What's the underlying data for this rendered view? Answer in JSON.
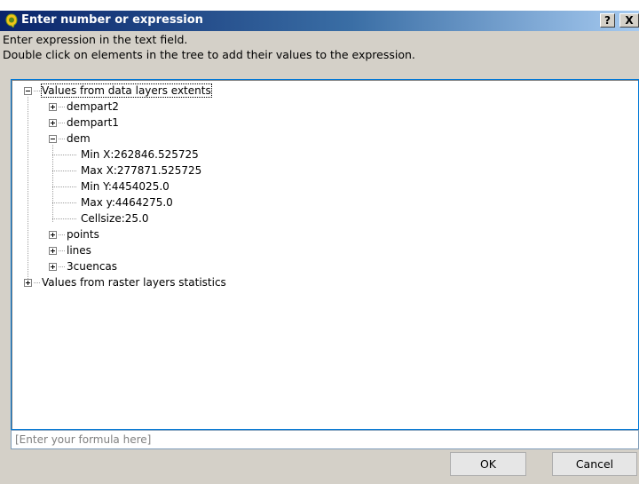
{
  "window": {
    "title": "Enter number or expression",
    "help_label": "?",
    "close_label": "X"
  },
  "instructions": {
    "line1": "Enter expression in the text field.",
    "line2": "Double click on elements in the tree to add their values to the expression."
  },
  "tree": {
    "extents_root": "Values from data layers extents",
    "layer_dempart2": "dempart2",
    "layer_dempart1": "dempart1",
    "layer_dem": "dem",
    "dem_min_x": "Min X:262846.525725",
    "dem_max_x": "Max X:277871.525725",
    "dem_min_y": "Min Y:4454025.0",
    "dem_max_y": "Max y:4464275.0",
    "dem_cellsize": "Cellsize:25.0",
    "layer_points": "points",
    "layer_lines": "lines",
    "layer_3cuencas": "3cuencas",
    "stats_root": "Values from raster layers statistics"
  },
  "formula": {
    "placeholder": "[Enter your formula here]",
    "value": ""
  },
  "buttons": {
    "ok": "OK",
    "cancel": "Cancel"
  },
  "colors": {
    "title_gradient_start": "#0a246a",
    "title_gradient_end": "#a6caf0",
    "dialog_background": "#d4d0c8",
    "tree_focus_border": "#0078d7"
  }
}
